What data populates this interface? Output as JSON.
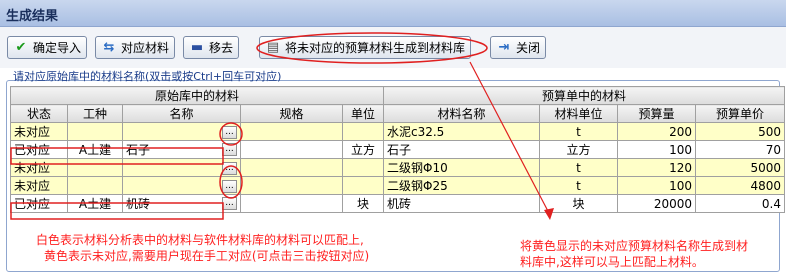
{
  "window": {
    "title": "生成结果"
  },
  "toolbar": {
    "confirm_label": "确定导入",
    "match_label": "对应材料",
    "remove_label": "移去",
    "generate_label": "将未对应的预算材料生成到材料库",
    "close_label": "关闭"
  },
  "hint": "请对应原始库中的材料名称(双击或按Ctrl+回车可对应)",
  "table": {
    "group_left": "原始库中的材料",
    "group_right": "预算单中的材料",
    "columns": [
      "状态",
      "工种",
      "名称",
      "规格",
      "单位",
      "材料名称",
      "材料单位",
      "预算量",
      "预算单价"
    ],
    "rows": [
      {
        "status": "未对应",
        "trade": "",
        "name": "",
        "spec": "",
        "unit": "",
        "mat": "水泥c32.5",
        "mat_unit": "t",
        "qty": "200",
        "price": "500"
      },
      {
        "status": "已对应",
        "trade": "A土建",
        "name": "石子",
        "spec": "",
        "unit": "立方",
        "mat": "石子",
        "mat_unit": "立方",
        "qty": "100",
        "price": "70"
      },
      {
        "status": "未对应",
        "trade": "",
        "name": "",
        "spec": "",
        "unit": "",
        "mat": "二级钢Φ10",
        "mat_unit": "t",
        "qty": "120",
        "price": "5000"
      },
      {
        "status": "未对应",
        "trade": "",
        "name": "",
        "spec": "",
        "unit": "",
        "mat": "二级钢Φ25",
        "mat_unit": "t",
        "qty": "100",
        "price": "4800"
      },
      {
        "status": "已对应",
        "trade": "A土建",
        "name": "机砖",
        "spec": "",
        "unit": "块",
        "mat": "机砖",
        "mat_unit": "块",
        "qty": "20000",
        "price": "0.4"
      }
    ],
    "pick_label": "..."
  },
  "annotations": {
    "left_line1": "白色表示材料分析表中的材料与软件材料库的材料可以匹配上,",
    "left_line2": "黄色表示未对应,需要用户现在手工对应(可点击三击按钮对应)",
    "right_line1": "将黄色显示的未对应预算材料名称生成到材",
    "right_line2": "料库中,这样可以马上匹配上材料。"
  },
  "colors": {
    "unmatched": "#ffffc8",
    "matched": "#ffffff",
    "annotation": "#ff2020",
    "highlight": "#e02020"
  }
}
